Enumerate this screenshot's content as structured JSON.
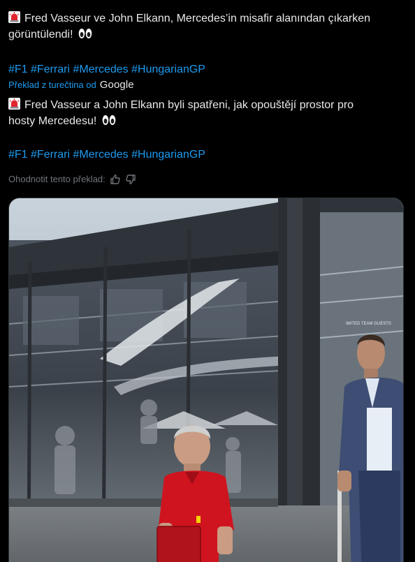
{
  "tweet": {
    "original_line1": "Fred Vasseur ve John Elkann, Mercedes’in misafir alanından çıkarken",
    "original_line2": "görüntülendi!",
    "original_hashtags": [
      "#F1",
      "#Ferrari",
      "#Mercedes",
      "#HungarianGP"
    ],
    "translated_from_label": "Překlad z turečtina od",
    "translator_brand": "Google",
    "translated_line1": "Fred Vasseur a John Elkann byli spatřeni, jak opouštějí prostor pro",
    "translated_line2": "hosty Mercedesu!",
    "translated_hashtags": [
      "#F1",
      "#Ferrari",
      "#Mercedes",
      "#HungarianGP"
    ],
    "rate_label": "Ohodnotit tento překlad:"
  },
  "icons": {
    "siren": "siren-emoji-icon",
    "eyes": "eyes-emoji-icon",
    "thumbs_up": "thumbs-up-icon",
    "thumbs_down": "thumbs-down-icon"
  },
  "media": {
    "sign_text": "IMITED TEAM GUESTS"
  },
  "colors": {
    "background": "#000000",
    "text": "#e7e9ea",
    "link": "#1d9bf0",
    "muted": "#71767b",
    "ferrari_red": "#d0141f"
  }
}
